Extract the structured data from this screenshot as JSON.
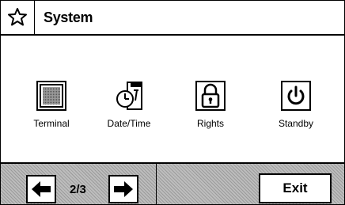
{
  "header": {
    "title": "System",
    "icon": "star-outline-icon"
  },
  "tiles": [
    {
      "label": "Terminal",
      "icon": "terminal-icon"
    },
    {
      "label": "Date/Time",
      "icon": "date-time-icon"
    },
    {
      "label": "Rights",
      "icon": "lock-icon"
    },
    {
      "label": "Standby",
      "icon": "power-icon"
    }
  ],
  "footer": {
    "page_indicator": "2/3",
    "exit_label": "Exit",
    "prev_icon": "arrow-left-icon",
    "next_icon": "arrow-right-icon"
  }
}
